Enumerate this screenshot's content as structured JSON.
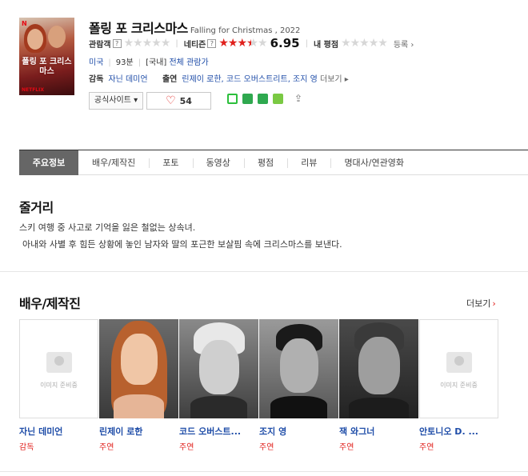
{
  "movie": {
    "title_ko": "폴링 포 크리스마스",
    "title_en": "Falling for Christmas , 2022",
    "poster_text": "폴링 포 크리스마스",
    "poster_brand": "N",
    "poster_brand_bottom": "NETFLIX",
    "audience_label": "관람객",
    "netizen_label": "네티즌",
    "netizen_score": "6.95",
    "netizen_score_value": 6.95,
    "my_rating_label": "내 평점",
    "register_label": "등록",
    "country": "미국",
    "runtime": "93분",
    "rating_prefix": "[국내]",
    "rating": "전체 관람가",
    "director_label": "감독",
    "director": "자닌 데미언",
    "cast_label": "출연",
    "cast_list": "린제이 로한, 코드 오버스트리트, 조지 영",
    "more_label": "더보기",
    "official_site_label": "공식사이트",
    "like_count": "54"
  },
  "tabs": [
    {
      "label": "주요정보",
      "active": true
    },
    {
      "label": "배우/제작진"
    },
    {
      "label": "포토"
    },
    {
      "label": "동영상"
    },
    {
      "label": "평점"
    },
    {
      "label": "리뷰"
    },
    {
      "label": "명대사/연관영화"
    }
  ],
  "synopsis": {
    "title": "줄거리",
    "line1": "스키 여행 중 사고로 기억을 잃은 철없는 상속녀.",
    "line2": "아내와 사별 후 힘든 상황에 놓인 남자와 딸의 포근한 보살핌 속에 크리스마스를 보낸다."
  },
  "cast_section": {
    "title": "배우/제작진",
    "more_label": "더보기",
    "no_image_text": "이미지 준비중",
    "people": [
      {
        "name": "자닌 데미언",
        "role": "감독",
        "has_photo": false
      },
      {
        "name": "린제이 로한",
        "role": "주연",
        "has_photo": true
      },
      {
        "name": "코드 오버스트...",
        "role": "주연",
        "has_photo": true
      },
      {
        "name": "조지 영",
        "role": "주연",
        "has_photo": true
      },
      {
        "name": "잭 와그너",
        "role": "주연",
        "has_photo": true
      },
      {
        "name": "안토니오 D. ...",
        "role": "주연",
        "has_photo": false
      }
    ]
  },
  "colors": {
    "accent_red": "#e0201c",
    "link_blue": "#1f4da8",
    "active_tab": "#666666"
  },
  "icons": [
    "help-icon",
    "heart-icon",
    "line-share-icon",
    "band-share-icon",
    "bookmark-share-icon",
    "blog-share-icon",
    "share-icon",
    "chevron-right-icon",
    "dropdown-arrow-icon",
    "no-image-icon"
  ]
}
